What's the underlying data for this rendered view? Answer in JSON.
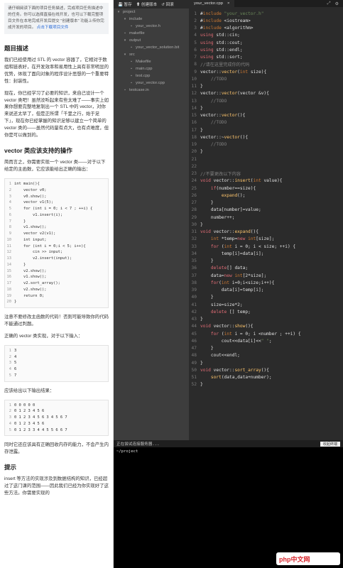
{
  "left": {
    "notice_text": "请仔细阅读下面的项目任务描述，完成项目任务描述中的任务。你可以选择直接在线开发，也可以下载完整项目文件在本地完成开发后提交 \"创建版本\" 功能上传你完成开发的项目。",
    "notice_link": "点击下载项目文件",
    "h_desc": "题目描述",
    "p1": "我们已经使用过 STL 的 vector 容器了，它相对于数组和链表好，在开发效率和易用性上具有非常明显的优势，体现了面向对象的程序设计思想的一个重要特性：封装性。",
    "p2": "现在，你已经学习了必要的知识，来自己设计一个 vector 类吧！虽然没听起来有些太难了——事实上如果你想要完整地复制出一个 STL 中的 vector，对你来说还太早了，但是正所谓「千里之行，始于足下」，现在你已经掌握的知识足够以建立一个简单的 vector 类的——虽然代码量有点大，也有点难度，但你是可以做到的。",
    "h_ops": "vector 类应该支持的操作",
    "p3": "简而言之，你需要实现一个 vector 类——对于以下给定的主函数，它应该能给出正确的输出：",
    "main_code": [
      "int main(){",
      "    vector v0;",
      "    v0.show();",
      "    vector v1(5);",
      "    for (int i = 0; i < 7 ; ++i) {",
      "        v1.insert(i);",
      "    }",
      "    v1.show();",
      "    vector v2(v1);",
      "    int input;",
      "    for (int i = 0;i < 5; i++){",
      "        cin >> input;",
      "        v2.insert(input);",
      "    }",
      "    v2.show();",
      "    v1.show();",
      "    v2.sort_array();",
      "    v2.show();",
      "    return 0;",
      "}"
    ],
    "p4": "注意不要修改主函数的代码！否则可能导致你的代码不能通过判题。",
    "p5": "正确的 vector 类实现，对于以下输入：",
    "input_lines": [
      "3",
      "4",
      "5",
      "6",
      "7"
    ],
    "p6": "应该给出以下输出结果：",
    "output_lines": [
      "0 0 0 0 0",
      "0 1 2 3 4 5 6",
      "0 1 2 3 4 5 6 3 4 5 6 7",
      "0 1 2 3 4 5 6",
      "0 1 2 3 3 4 4 5 5 6 6 7"
    ],
    "p7": "同时它还应该具有正确回收内存的能力，不会产生内存泄露。",
    "h_tip": "提示",
    "p8": "insert 等方法的实现涉及到数据结构的知识，已经超过了这门课的范围——因此我们已经为你实现好了这些方法。你需要实现的"
  },
  "tree": {
    "toolbar": [
      "暂存",
      "创建版本",
      "回滚"
    ],
    "items": [
      {
        "label": "project",
        "depth": 0,
        "icon": "folder-open-icon"
      },
      {
        "label": "include",
        "depth": 1,
        "icon": "folder-open-icon"
      },
      {
        "label": "your_vector.h",
        "depth": 2,
        "icon": "file-icon"
      },
      {
        "label": "makefile",
        "depth": 1,
        "icon": "file-icon"
      },
      {
        "label": "output",
        "depth": 1,
        "icon": "folder-open-icon"
      },
      {
        "label": "your_vector_solution.bit",
        "depth": 2,
        "icon": "file-icon"
      },
      {
        "label": "src",
        "depth": 1,
        "icon": "folder-open-icon"
      },
      {
        "label": "Makefile",
        "depth": 2,
        "icon": "file-icon"
      },
      {
        "label": "main.cpp",
        "depth": 2,
        "icon": "file-icon"
      },
      {
        "label": "test.cpp",
        "depth": 2,
        "icon": "file-icon"
      },
      {
        "label": "your_vector.cpp",
        "depth": 2,
        "icon": "file-icon"
      },
      {
        "label": "testcase.in",
        "depth": 1,
        "icon": "file-icon"
      }
    ]
  },
  "editor": {
    "tab": "your_vector.cpp",
    "lines": [
      "#include \"your_vector.h\"",
      "#include <iostream>",
      "#include <algorithm>",
      "using std::cin;",
      "using std::cout;",
      "using std::endl;",
      "using std::sort;",
      "//请在这里完成你的代码",
      "vector::vector(int size){",
      "    //TODO",
      "}",
      "vector::vector(vector &v){",
      "    //TODO",
      "}",
      "vector::vector(){",
      "    //TODO",
      "}",
      "vector::~vector(){",
      "    //TODO",
      "}",
      "",
      "",
      "//不要更改以下内容",
      "void vector::insert(int value){",
      "    if(number==size){",
      "        expand();",
      "    }",
      "    data[number]=value;",
      "    number++;",
      "}",
      "void vector::expand(){",
      "    int *temp=new int[size];",
      "    for (int i = 0; i < size; ++i) {",
      "        temp[i]=data[i];",
      "    }",
      "    delete[] data;",
      "    data=new int[2*size];",
      "    for(int i=0;i<size;i++){",
      "        data[i]=temp[i];",
      "    }",
      "    size=size*2;",
      "    delete [] temp;",
      "}",
      "void vector::show(){",
      "    for (int i = 0; i <number ; ++i) {",
      "        cout<<data[i]<<\" \";",
      "    }",
      "    cout<<endl;",
      "}",
      "void vector::sort_array(){",
      "    sort(data,data+number);",
      "}"
    ]
  },
  "terminal": {
    "header": "正在尝试连接服务器...",
    "button": "收起终端",
    "lines": [
      "~/project"
    ]
  },
  "watermark": {
    "logo": "php中文网",
    "domain": ""
  }
}
